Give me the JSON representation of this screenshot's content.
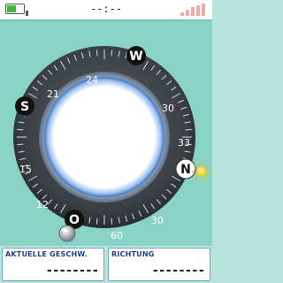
{
  "status": {
    "battery_level": 0.55,
    "battery_color": "#3bbf3b",
    "clock": "--:--",
    "signal_color": "#f4a9a9"
  },
  "compass": {
    "ticks": [
      "24",
      "30",
      "33",
      "30",
      "60",
      "12",
      "15",
      "21"
    ],
    "cardinals": [
      "W",
      "S",
      "N",
      "O"
    ],
    "bezel_color": "#2f3336",
    "face_color": "#ffffff",
    "marker_icons": [
      "sun-icon",
      "gps-ball-icon"
    ]
  },
  "panels": {
    "left": {
      "label": "AKTUELLE GESCHW.",
      "value": "--------"
    },
    "right": {
      "label": "RICHTUNG",
      "value": "--------"
    }
  }
}
